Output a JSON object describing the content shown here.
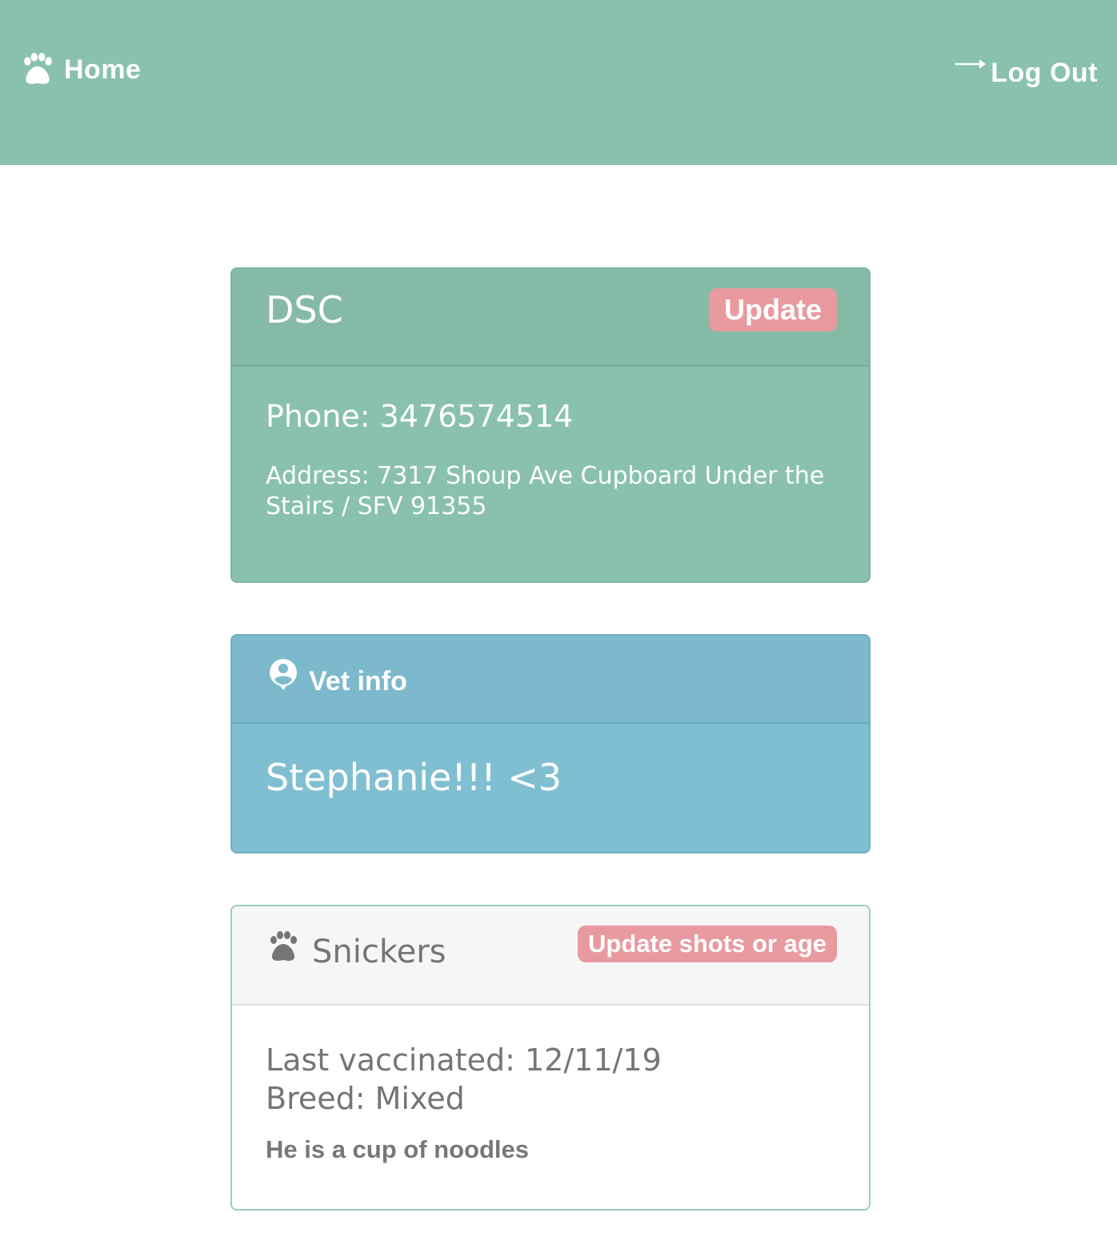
{
  "nav": {
    "home_label": "Home",
    "home_icon": "paw-icon",
    "logout_label": "Log Out",
    "logout_icon": "arrow-right-icon"
  },
  "organization": {
    "name": "DSC",
    "update_label": "Update",
    "phone": "Phone: 3476574514",
    "address": "Address: 7317 Shoup Ave Cupboard Under the Stairs / SFV 91355"
  },
  "vet": {
    "header_label": "Vet info",
    "header_icon": "person-pin-icon",
    "name": "Stephanie!!! <3"
  },
  "pet": {
    "name": "Snickers",
    "icon": "paw-icon",
    "update_label": "Update shots or age",
    "last_vaccinated": "Last vaccinated: 12/11/19",
    "breed": "Breed: Mixed",
    "notes": "He is a cup of noodles"
  },
  "colors": {
    "navbar": "#89c1ac",
    "org_card": "#89c1ac",
    "vet_card": "#80bfd2",
    "accent_button": "#e89a9f",
    "pet_header": "#f6f6f6",
    "muted_text": "#757575"
  }
}
